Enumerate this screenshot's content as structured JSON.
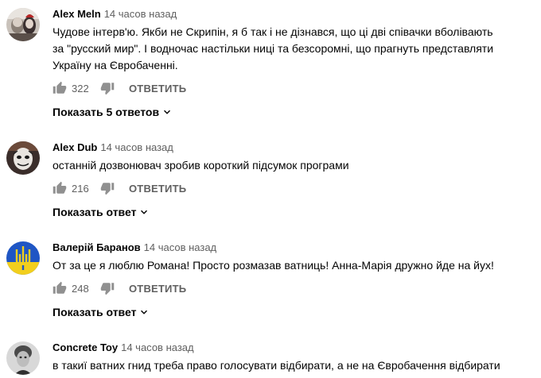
{
  "comments": [
    {
      "author": "Alex Meln",
      "time": "14 часов назад",
      "text": "Чудове інтерв'ю. Якби не Скрипін, я б так і не дізнався, що ці дві співачки вболівають\nза \"русский мир\". І водночас настільки ниці та безсоромні, що прагнуть представляти\nУкраїну на Євробаченні.",
      "likes": "322",
      "reply_label": "ОТВЕТИТЬ",
      "replies_label": "Показать 5 ответов",
      "avatar_icon": "avatar-two-faces-icon"
    },
    {
      "author": "Alex Dub",
      "time": "14 часов назад",
      "text": "останній дозвонювач зробив короткий підсумок програми",
      "likes": "216",
      "reply_label": "ОТВЕТИТЬ",
      "replies_label": "Показать ответ",
      "avatar_icon": "avatar-mask-icon"
    },
    {
      "author": "Валерій Баранов",
      "time": "14 часов назад",
      "text": "От за це я люблю Романа! Просто розмазав ватниць! Анна-Марія дружно йде на йух!",
      "likes": "248",
      "reply_label": "ОТВЕТИТЬ",
      "replies_label": "Показать ответ",
      "avatar_icon": "avatar-trident-icon"
    },
    {
      "author": "Concrete Toy",
      "time": "14 часов назад",
      "text": "в такиї ватних гнид треба право голосувати відбирати, а не на Євробачення відбирати",
      "avatar_icon": "avatar-portrait-icon"
    }
  ],
  "colors": {
    "text": "#030303",
    "muted": "#606060",
    "background": "#ffffff"
  }
}
